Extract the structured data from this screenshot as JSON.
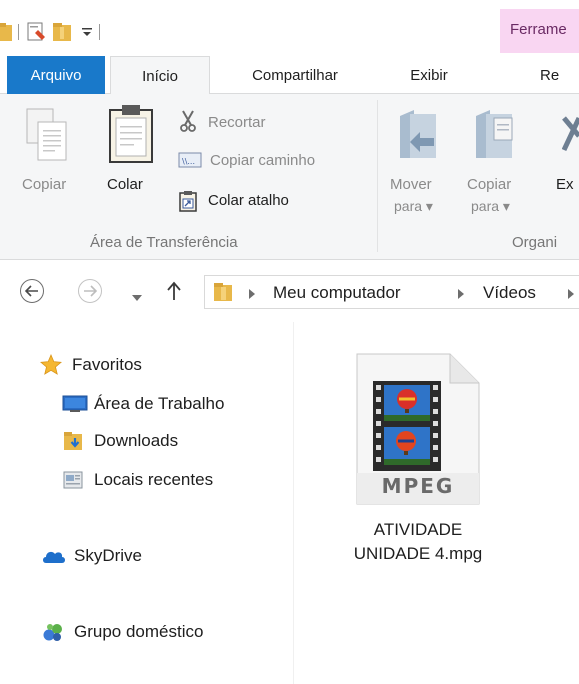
{
  "titlebar": {
    "contextual_tab": "Ferrame"
  },
  "tabs": {
    "file": "Arquivo",
    "home": "Início",
    "share": "Compartilhar",
    "view": "Exibir",
    "partial": "Re"
  },
  "ribbon": {
    "copy": "Copiar",
    "paste": "Colar",
    "cut": "Recortar",
    "copy_path": "Copiar caminho",
    "paste_shortcut": "Colar atalho",
    "clipboard_group": "Área de Transferência",
    "move_to_line1": "Mover",
    "move_to_line2": "para ▾",
    "copy_to_line1": "Copiar",
    "copy_to_line2": "para ▾",
    "partial_ex": "Ex",
    "organize_group": "Organi"
  },
  "address": {
    "crumbs": [
      "Meu computador",
      "Vídeos"
    ]
  },
  "navpane": {
    "favorites": "Favoritos",
    "desktop": "Área de Trabalho",
    "downloads": "Downloads",
    "recent": "Locais recentes",
    "skydrive": "SkyDrive",
    "homegroup": "Grupo doméstico"
  },
  "files": [
    {
      "name_line1": "ATIVIDADE",
      "name_line2": "UNIDADE 4.mpg",
      "badge": "MPEG"
    }
  ],
  "colors": {
    "file_tab": "#1979ca",
    "contextual_tab": "#f9d6f2",
    "ribbon_bg": "#f5f6f7"
  }
}
